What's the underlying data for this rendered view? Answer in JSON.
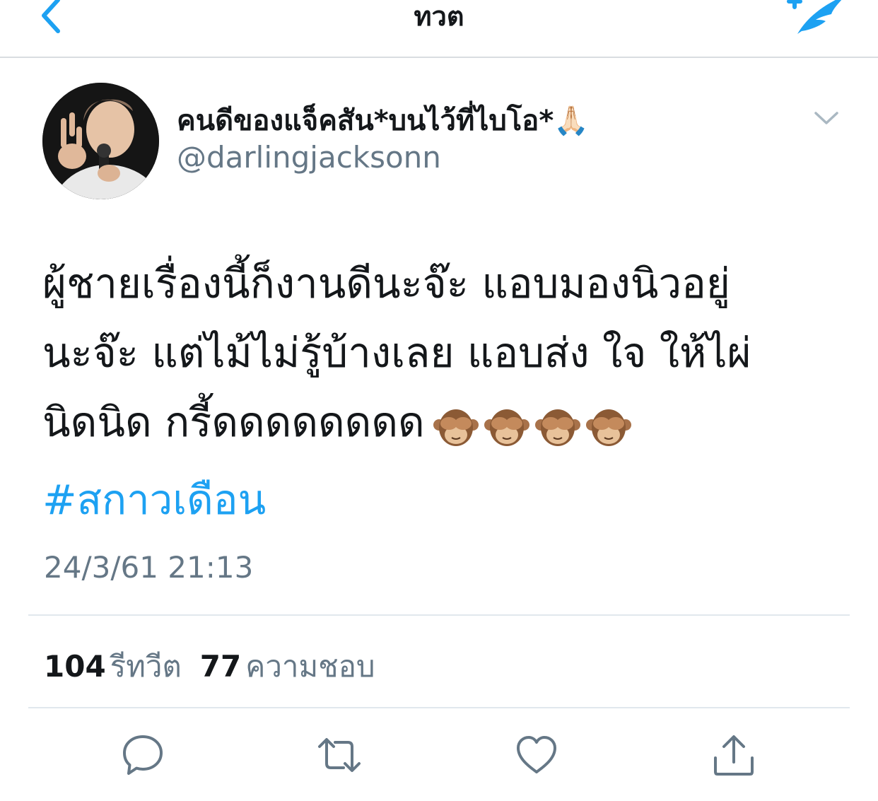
{
  "nav": {
    "title": "ทวต",
    "back_icon": "chevron-left-icon",
    "compose_icon": "compose-quill-icon"
  },
  "tweet": {
    "author": {
      "display_name": "คนดีของแจ็คสัน*บนไว้ที่ไบโอ*🙏🏻",
      "handle": "@darlingjacksonn",
      "avatar": "avatar-photo"
    },
    "text_lines": [
      "ผู้ชายเรื่องนี้ก็งานดีนะจ๊ะ แอบมองนิวอยู่",
      "นะจ๊ะ แต่ไม้ไม่รู้บ้างเลย แอบส่ง ใจ ให้ไผ่",
      "นิดนิด  กรี้ดดดดดดดด"
    ],
    "emoji": [
      "🙈",
      "🙈",
      "🙈",
      "🙈"
    ],
    "hashtag": "#สกาวเดือน",
    "timestamp": "24/3/61 21:13",
    "stats": {
      "retweets_count": "104",
      "retweets_label": "รีทวีต",
      "likes_count": "77",
      "likes_label": "ความชอบ"
    }
  },
  "actions": {
    "reply_icon": "reply-icon",
    "retweet_icon": "retweet-icon",
    "like_icon": "heart-icon",
    "share_icon": "share-icon"
  },
  "colors": {
    "accent": "#1da1f2",
    "text": "#14171a",
    "secondary": "#657786",
    "divider": "#e1e8ed"
  }
}
